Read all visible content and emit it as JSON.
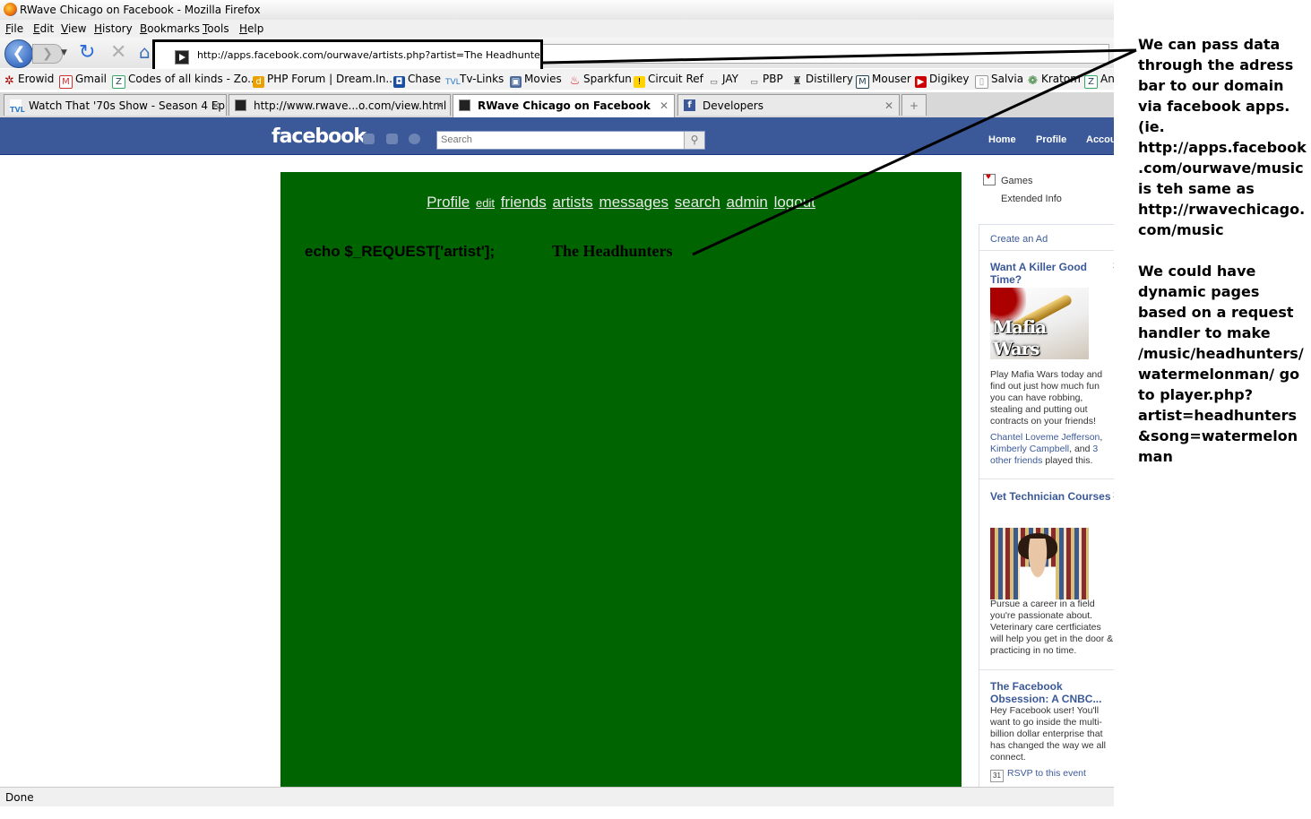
{
  "window": {
    "title": "RWave Chicago on Facebook - Mozilla Firefox"
  },
  "menu": [
    "File",
    "Edit",
    "View",
    "History",
    "Bookmarks",
    "Tools",
    "Help"
  ],
  "url": "http://apps.facebook.com/ourwave/artists.php?artist=The Headhunters",
  "bookmarks": [
    "Erowid",
    "Gmail",
    "Codes of all kinds - Zo...",
    "PHP Forum | Dream.In...",
    "Chase",
    "Tv-Links",
    "Movies",
    "Sparkfun",
    "Circuit Ref",
    "JAY",
    "PBP",
    "Distillery",
    "Mouser",
    "Digikey",
    "Salvia",
    "Kratom",
    "An"
  ],
  "tabs": [
    {
      "label": "Watch That '70s Show - Season 4 Ep...",
      "active": false
    },
    {
      "label": "http://www.rwave...o.com/view.html",
      "active": false
    },
    {
      "label": "RWave Chicago on Facebook",
      "active": true
    },
    {
      "label": "Developers",
      "active": false
    }
  ],
  "facebook": {
    "logo": "facebook",
    "search_placeholder": "Search",
    "nav": [
      "Home",
      "Profile",
      "Accou"
    ]
  },
  "app": {
    "nav": [
      "Profile",
      "edit",
      "friends",
      "artists",
      "messages",
      "search",
      "admin",
      "logout"
    ],
    "code": "echo $_REQUEST['artist'];",
    "artist": "The Headhunters",
    "bg_color": "#006400"
  },
  "sidebar": {
    "games": "Games",
    "extended_info": "Extended Info",
    "create_ad": "Create an Ad",
    "ads": [
      {
        "title": "Want A Killer Good Time?",
        "image_text": "Mafia Wars",
        "body": "Play Mafia Wars today and find out just how much fun you can have robbing, stealing and putting out contracts on your friends!",
        "friend1": "Chantel Loveme Jefferson",
        "sep": ",",
        "friend2": "Kimberly Campbell",
        "and": ", and",
        "friends_more": "3 other friends",
        "played": "played this."
      },
      {
        "title": "Vet Technician Courses",
        "body": "Pursue a career in a field you're passionate about. Veterinary care certficiates will help you get in the door & practicing in no time."
      },
      {
        "title": "The Facebook Obsession: A CNBC...",
        "body": "Hey Facebook user! You'll want to go inside the multi-billion dollar enterprise that has changed the way we all connect.",
        "rsvp": "RSVP to this event",
        "cal_day": "31"
      }
    ],
    "close": "x"
  },
  "status": "Done",
  "annotation": {
    "para1": "We can pass data through the adress bar to our domain via facebook apps. (ie. http://apps.facebook.com/ourwave/music is teh same as http://rwavechicago.com/music",
    "para2": "We could have dynamic pages based on a request handler to make /music/headhunters/watermelonman/ go to player.php?artist=headhunters&song=watermelonman"
  }
}
